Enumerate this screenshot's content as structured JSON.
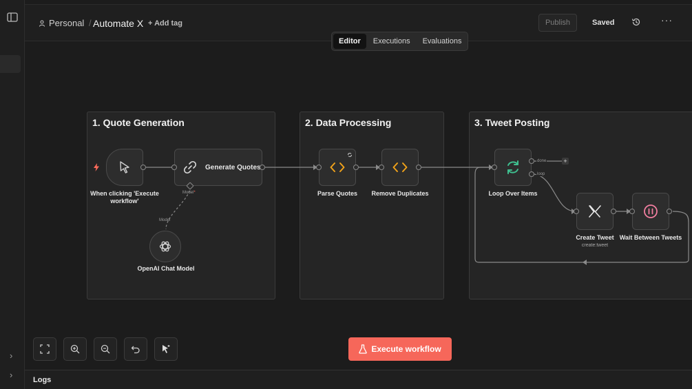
{
  "header": {
    "project": "Personal",
    "separator": "/",
    "workflow_name": "Automate X",
    "add_tag": "+ Add tag",
    "publish": "Publish",
    "saved": "Saved",
    "more": "···"
  },
  "tabs": [
    {
      "label": "Editor",
      "active": true
    },
    {
      "label": "Executions",
      "active": false
    },
    {
      "label": "Evaluations",
      "active": false
    }
  ],
  "groups": [
    {
      "title": "1. Quote Generation"
    },
    {
      "title": "2. Data Processing"
    },
    {
      "title": "3. Tweet Posting"
    }
  ],
  "nodes": {
    "trigger": "When clicking 'Execute workflow'",
    "generate": "Generate Quotes",
    "openai": "OpenAI Chat Model",
    "parse": "Parse Quotes",
    "dedupe": "Remove Duplicates",
    "loop": "Loop Over Items",
    "tweet": "Create Tweet",
    "tweet_sub": "create:tweet",
    "wait": "Wait Between Tweets"
  },
  "port_labels": {
    "model_top": "Model",
    "model_bottom": "Model",
    "done": "done",
    "loop": "loop",
    "required": "*"
  },
  "execute_button": "Execute workflow",
  "logs": "Logs",
  "colors": {
    "accent": "#f6675a",
    "code_icon": "#f0a21a",
    "loop_icon": "#3fbf8f",
    "wait_icon": "#f37fa1",
    "trigger_bolt": "#ff6b5b"
  }
}
